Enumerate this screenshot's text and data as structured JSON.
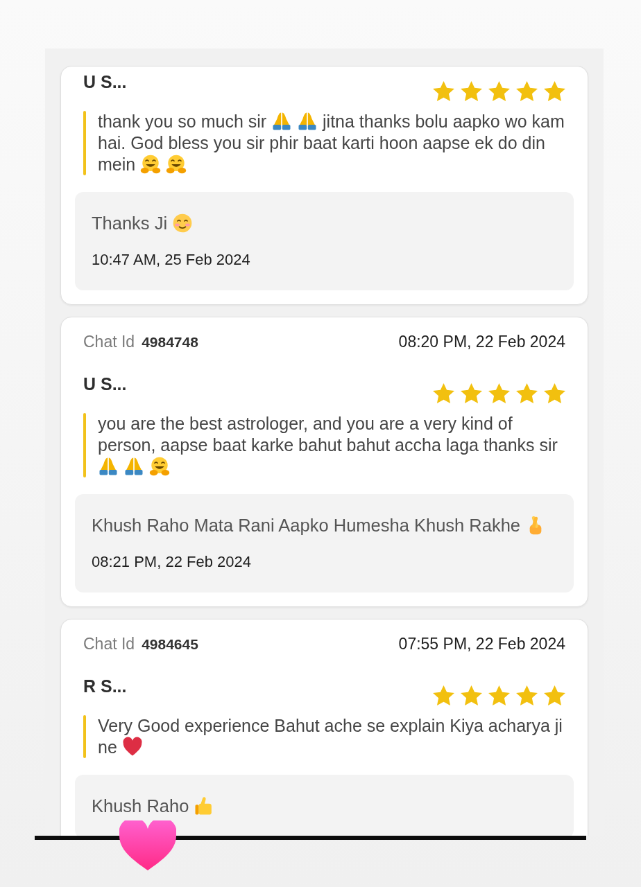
{
  "reviews": [
    {
      "name": "U S...",
      "stars": 5,
      "comment": [
        {
          "kind": "text",
          "text": "thank you so much sir"
        },
        {
          "kind": "pray"
        },
        {
          "kind": "pray"
        },
        {
          "kind": "text",
          "text": "jitna thanks bolu aapko wo kam hai. God bless you sir phir baat karti hoon aapse ek do din mein"
        },
        {
          "kind": "hug"
        },
        {
          "kind": "hug"
        }
      ],
      "reply": [
        {
          "kind": "text",
          "text": "Thanks Ji"
        },
        {
          "kind": "smile"
        }
      ],
      "reply_time": "10:47 AM, 25 Feb 2024"
    },
    {
      "chat_id_label": "Chat Id",
      "chat_id": "4984748",
      "time": "08:20 PM, 22 Feb 2024",
      "name": "U S...",
      "stars": 5,
      "comment": [
        {
          "kind": "text",
          "text": "you are the best astrologer, and you are a very kind of person, aapse baat karke bahut bahut accha laga thanks sir"
        },
        {
          "kind": "pray"
        },
        {
          "kind": "pray"
        },
        {
          "kind": "hug"
        }
      ],
      "reply": [
        {
          "kind": "text",
          "text": "Khush Raho Mata Rani Aapko Humesha Khush Rakhe"
        },
        {
          "kind": "crossed"
        }
      ],
      "reply_time": "08:21 PM, 22 Feb 2024"
    },
    {
      "chat_id_label": "Chat Id",
      "chat_id": "4984645",
      "time": "07:55 PM, 22 Feb 2024",
      "name": "R S...",
      "stars": 5,
      "comment": [
        {
          "kind": "text",
          "text": "Very Good experience Bahut ache se explain Kiya acharya ji ne"
        },
        {
          "kind": "heart"
        }
      ],
      "reply": [
        {
          "kind": "text",
          "text": "Khush Raho"
        },
        {
          "kind": "thumbsup"
        }
      ]
    }
  ],
  "sticker": {
    "kind": "heart"
  }
}
